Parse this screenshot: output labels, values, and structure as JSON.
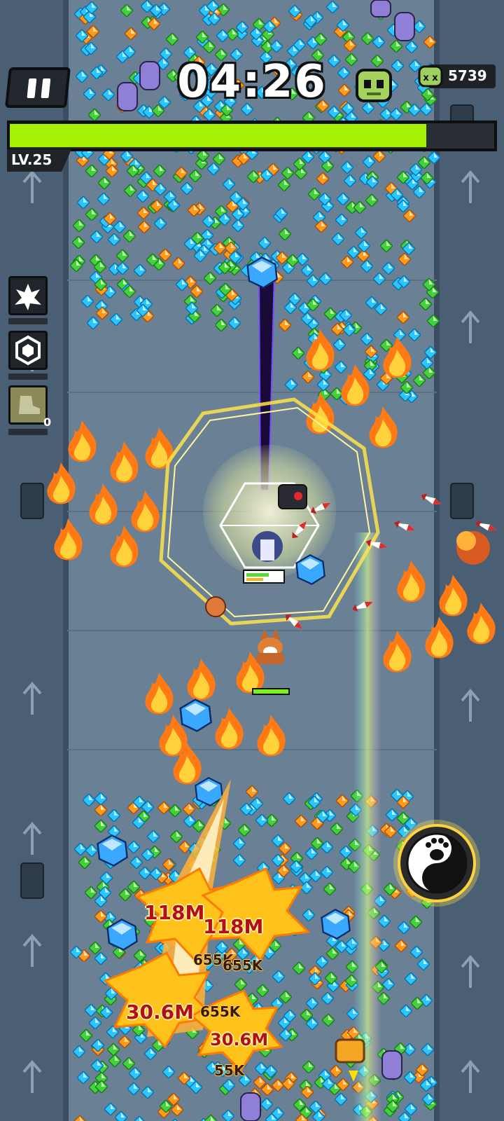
{
  "hud": {
    "timer": "04:26",
    "kill_count": "5739",
    "level": "LV.25",
    "xp_progress": 0.86,
    "skill_item_count": "0"
  },
  "damage_numbers": {
    "big": [
      "118M",
      "118M",
      "30.6M",
      "30.6M"
    ],
    "small": [
      "655K",
      "655K",
      "655K",
      "55K"
    ]
  },
  "icons": {
    "pause": "pause-icon",
    "zombie": "zombie-head-icon",
    "skull": "skull-icon",
    "skill1": "explosion-skill-icon",
    "skill2": "hexagon-shield-skill-icon",
    "skill3": "boot-skill-icon",
    "joystick": "yin-yang-paw-icon"
  },
  "colors": {
    "xp": "#a5f104",
    "road": "#4a5f73",
    "floor": "#6a8094",
    "fire": "#ff8a1e",
    "gem_blue": "#29c6ff",
    "gem_green": "#43d13c",
    "gem_orange": "#ff9a1a"
  }
}
